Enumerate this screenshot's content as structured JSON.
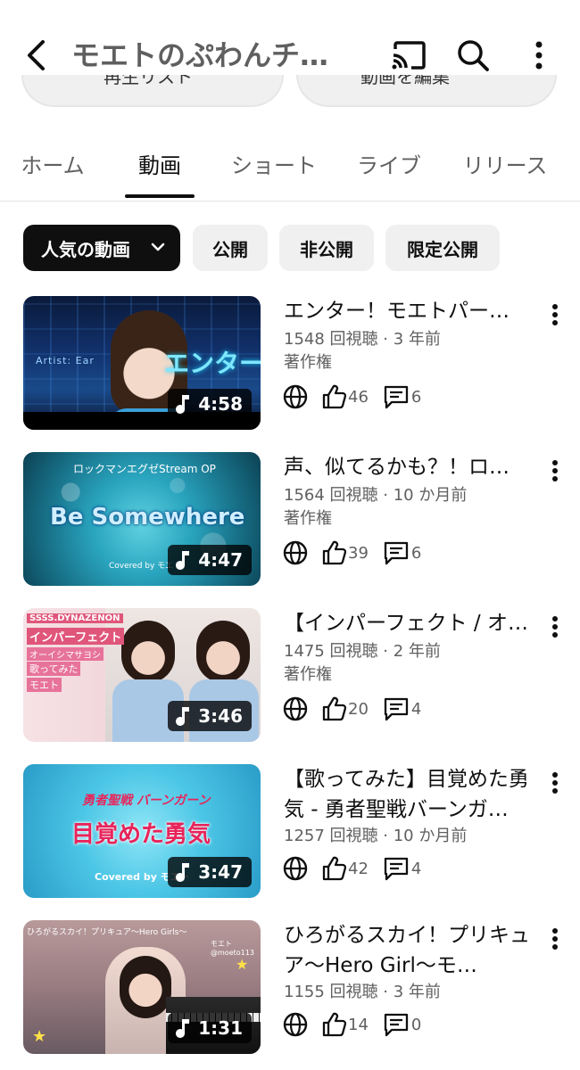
{
  "header": {
    "title": "モエトのぷわんチ…",
    "pill_left": "再生リスト",
    "pill_right": "動画を編集"
  },
  "tabs": [
    {
      "label": "ホーム"
    },
    {
      "label": "動画"
    },
    {
      "label": "ショート"
    },
    {
      "label": "ライブ"
    },
    {
      "label": "リリース"
    }
  ],
  "active_tab": "動画",
  "filters": [
    {
      "label": "人気の動画"
    },
    {
      "label": "公開"
    },
    {
      "label": "非公開"
    },
    {
      "label": "限定公開"
    }
  ],
  "videos": [
    {
      "title": "エンター！モエトパー…",
      "meta": "1548 回視聴 · 3 年前",
      "license": "著作権",
      "likes": "46",
      "comments": "6",
      "duration": "4:58",
      "thumb_title": "エンター！",
      "thumb_sub": "Artist: Ear"
    },
    {
      "title": "声、似てるかも？！ロ…",
      "meta": "1564 回視聴 · 10 か月前",
      "license": "著作権",
      "likes": "39",
      "comments": "6",
      "duration": "4:47",
      "thumb_top": "ロックマンエグゼStream OP",
      "thumb_title": "Be Somewhere",
      "thumb_sub": "Covered by モエト"
    },
    {
      "title": "【インパーフェクト / オ…",
      "meta": "1475 回視聴 · 2 年前",
      "license": "著作権",
      "likes": "20",
      "comments": "4",
      "duration": "3:46",
      "thumb_lines": [
        "SSSS.DYNAZENON",
        "インパーフェクト",
        "オーイシマサヨシ",
        "歌ってみた",
        "モエト"
      ]
    },
    {
      "title": "【歌ってみた】目覚めた勇気 - 勇者聖戦バーンガ…",
      "meta": "1257 回視聴 · 10 か月前",
      "likes": "42",
      "comments": "4",
      "duration": "3:47",
      "thumb_top": "勇者聖戦 バーンガーン",
      "thumb_title": "目覚めた勇気",
      "thumb_sub": "Covered by モエト"
    },
    {
      "title": "ひろがるスカイ！プリキュア〜Hero Girl〜モ…",
      "meta": "1155 回視聴 · 3 年前",
      "likes": "14",
      "comments": "0",
      "duration": "1:31",
      "thumb_top": "ひろがるスカイ！プリキュア〜Hero Girls〜",
      "thumb_sub": "モエト @moeto113"
    }
  ],
  "colors": {
    "text_primary": "#0f0f0f",
    "text_secondary": "#606060",
    "chip_bg": "#f0f0f0",
    "chip_active_bg": "#0f0f0f"
  }
}
